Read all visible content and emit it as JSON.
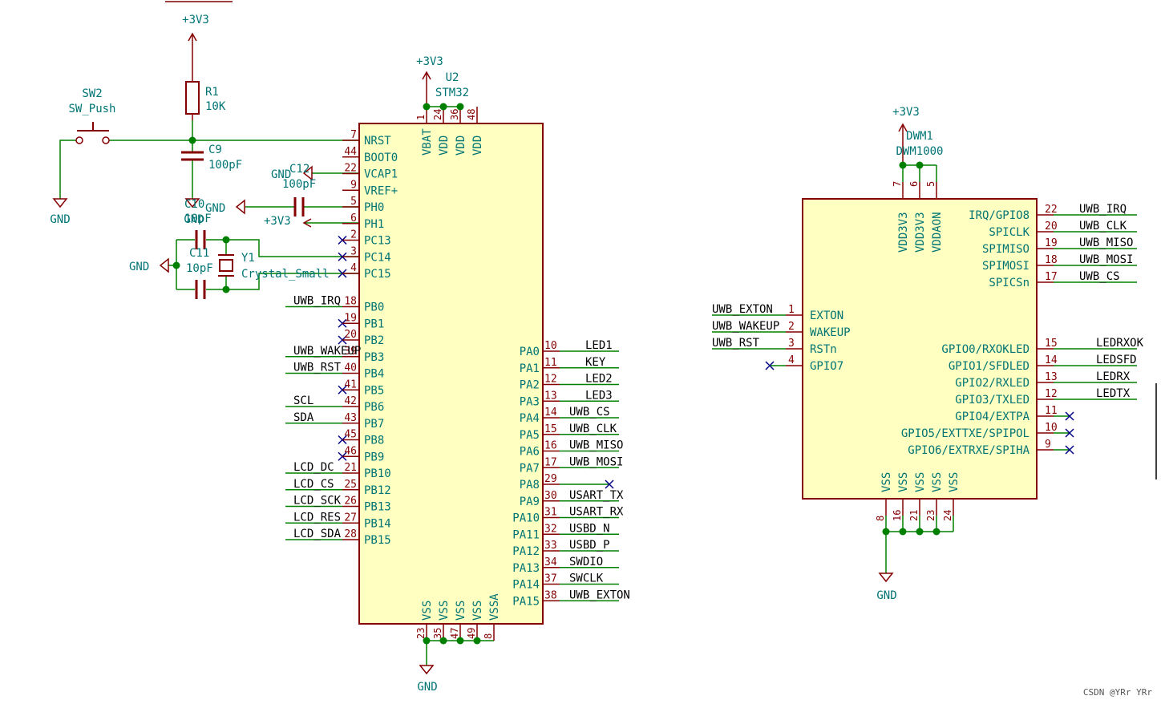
{
  "colors": {
    "wire": "#008000",
    "component": "#840000",
    "body_fill": "#ffffc2",
    "text": "#007474",
    "no_connect": "#000084",
    "junction": "#008000"
  },
  "power": {
    "v33": "+3V3",
    "gnd": "GND"
  },
  "sw2": {
    "ref": "SW2",
    "value": "SW_Push"
  },
  "r1": {
    "ref": "R1",
    "value": "10K"
  },
  "c9": {
    "ref": "C9",
    "value": "100pF"
  },
  "c12": {
    "ref": "C12",
    "value": "100pF"
  },
  "c10": {
    "ref": "C10",
    "value": "10pF"
  },
  "c11": {
    "ref": "C11",
    "value": "10pF"
  },
  "y1": {
    "ref": "Y1",
    "value": "Crystal_Small"
  },
  "u2": {
    "ref": "U2",
    "value": "STM32",
    "top": [
      {
        "pin": "1",
        "name": "VBAT"
      },
      {
        "pin": "24",
        "name": "VDD"
      },
      {
        "pin": "36",
        "name": "VDD"
      },
      {
        "pin": "48",
        "name": "VDD"
      }
    ],
    "bottom": [
      {
        "pin": "23",
        "name": "VSS"
      },
      {
        "pin": "35",
        "name": "VSS"
      },
      {
        "pin": "47",
        "name": "VSS"
      },
      {
        "pin": "49",
        "name": "VSS"
      },
      {
        "pin": "8",
        "name": "VSSA"
      }
    ],
    "left": [
      {
        "pin": "7",
        "name": "NRST",
        "net": ""
      },
      {
        "pin": "44",
        "name": "BOOT0",
        "net": ""
      },
      {
        "pin": "22",
        "name": "VCAP1",
        "net": ""
      },
      {
        "pin": "9",
        "name": "VREF+",
        "net": ""
      },
      {
        "pin": "5",
        "name": "PH0",
        "net": ""
      },
      {
        "pin": "6",
        "name": "PH1",
        "net": ""
      },
      {
        "pin": "2",
        "name": "PC13",
        "net": "",
        "nc": true
      },
      {
        "pin": "3",
        "name": "PC14",
        "net": "",
        "nc": true
      },
      {
        "pin": "4",
        "name": "PC15",
        "net": "",
        "nc": true
      },
      {
        "pin": "18",
        "name": "PB0",
        "net": "UWB_IRQ"
      },
      {
        "pin": "19",
        "name": "PB1",
        "net": "",
        "nc": true
      },
      {
        "pin": "20",
        "name": "PB2",
        "net": "",
        "nc": true
      },
      {
        "pin": "39",
        "name": "PB3",
        "net": "UWB_WAKEUP"
      },
      {
        "pin": "40",
        "name": "PB4",
        "net": "UWB_RST"
      },
      {
        "pin": "41",
        "name": "PB5",
        "net": "",
        "nc": true
      },
      {
        "pin": "42",
        "name": "PB6",
        "net": "SCL"
      },
      {
        "pin": "43",
        "name": "PB7",
        "net": "SDA"
      },
      {
        "pin": "45",
        "name": "PB8",
        "net": "",
        "nc": true
      },
      {
        "pin": "46",
        "name": "PB9",
        "net": "",
        "nc": true
      },
      {
        "pin": "21",
        "name": "PB10",
        "net": "LCD_DC"
      },
      {
        "pin": "25",
        "name": "PB12",
        "net": "LCD_CS"
      },
      {
        "pin": "26",
        "name": "PB13",
        "net": "LCD_SCK"
      },
      {
        "pin": "27",
        "name": "PB14",
        "net": "LCD_RES"
      },
      {
        "pin": "28",
        "name": "PB15",
        "net": "LCD_SDA"
      }
    ],
    "right": [
      {
        "pin": "10",
        "name": "PA0",
        "net": "LED1"
      },
      {
        "pin": "11",
        "name": "PA1",
        "net": "KEY"
      },
      {
        "pin": "12",
        "name": "PA2",
        "net": "LED2"
      },
      {
        "pin": "13",
        "name": "PA3",
        "net": "LED3"
      },
      {
        "pin": "14",
        "name": "PA4",
        "net": "UWB_CS"
      },
      {
        "pin": "15",
        "name": "PA5",
        "net": "UWB_CLK"
      },
      {
        "pin": "16",
        "name": "PA6",
        "net": "UWB_MISO"
      },
      {
        "pin": "17",
        "name": "PA7",
        "net": "UWB_MOSI"
      },
      {
        "pin": "29",
        "name": "PA8",
        "net": "",
        "nc": true
      },
      {
        "pin": "30",
        "name": "PA9",
        "net": "USART_TX"
      },
      {
        "pin": "31",
        "name": "PA10",
        "net": "USART_RX"
      },
      {
        "pin": "32",
        "name": "PA11",
        "net": "USBD_N"
      },
      {
        "pin": "33",
        "name": "PA12",
        "net": "USBD_P"
      },
      {
        "pin": "34",
        "name": "PA13",
        "net": "SWDIO"
      },
      {
        "pin": "37",
        "name": "PA14",
        "net": "SWCLK"
      },
      {
        "pin": "38",
        "name": "PA15",
        "net": "UWB_EXTON"
      }
    ]
  },
  "dwm1": {
    "ref": "DWM1",
    "value": "DWM1000",
    "top": [
      {
        "pin": "7",
        "name": "VDD3V3"
      },
      {
        "pin": "6",
        "name": "VDD3V3"
      },
      {
        "pin": "5",
        "name": "VDDAON"
      }
    ],
    "bottom": [
      {
        "pin": "8",
        "name": "VSS"
      },
      {
        "pin": "16",
        "name": "VSS"
      },
      {
        "pin": "21",
        "name": "VSS"
      },
      {
        "pin": "23",
        "name": "VSS"
      },
      {
        "pin": "24",
        "name": "VSS"
      }
    ],
    "left": [
      {
        "pin": "1",
        "name": "EXTON",
        "net": "UWB_EXTON"
      },
      {
        "pin": "2",
        "name": "WAKEUP",
        "net": "UWB_WAKEUP"
      },
      {
        "pin": "3",
        "name": "RSTn",
        "net": "UWB_RST"
      },
      {
        "pin": "4",
        "name": "GPIO7",
        "net": "",
        "nc": true
      }
    ],
    "right": [
      {
        "pin": "22",
        "name": "IRQ/GPIO8",
        "net": "UWB_IRQ"
      },
      {
        "pin": "20",
        "name": "SPICLK",
        "net": "UWB_CLK"
      },
      {
        "pin": "19",
        "name": "SPIMISO",
        "net": "UWB_MISO"
      },
      {
        "pin": "18",
        "name": "SPIMOSI",
        "net": "UWB_MOSI"
      },
      {
        "pin": "17",
        "name": "SPICSn",
        "net": "UWB_CS"
      },
      {
        "pin": "15",
        "name": "GPIO0/RXOKLED",
        "net": "LEDRXOK"
      },
      {
        "pin": "14",
        "name": "GPIO1/SFDLED",
        "net": "LEDSFD"
      },
      {
        "pin": "13",
        "name": "GPIO2/RXLED",
        "net": "LEDRX"
      },
      {
        "pin": "12",
        "name": "GPIO3/TXLED",
        "net": "LEDTX"
      },
      {
        "pin": "11",
        "name": "GPIO4/EXTPA",
        "net": "",
        "nc": true
      },
      {
        "pin": "10",
        "name": "GPIO5/EXTTXE/SPIPOL",
        "net": "",
        "nc": true
      },
      {
        "pin": "9",
        "name": "GPIO6/EXTRXE/SPIHA",
        "net": "",
        "nc": true
      }
    ]
  },
  "watermark": "CSDN @YRr YRr"
}
